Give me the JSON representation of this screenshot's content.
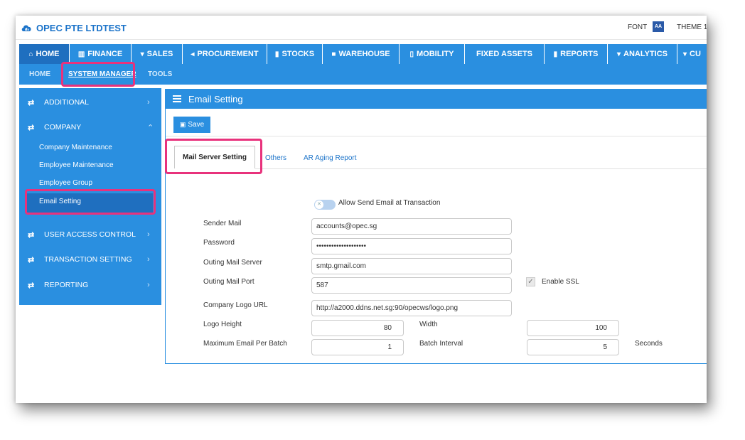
{
  "app": {
    "title": "OPEC PTE LTDTEST",
    "font_label": "FONT",
    "font_icon_text": "AA",
    "theme_label": "THEME 1"
  },
  "topnav": [
    {
      "label": "HOME",
      "icon": "home-icon"
    },
    {
      "label": "FINANCE",
      "icon": "bank-icon"
    },
    {
      "label": "SALES",
      "icon": "cart-icon"
    },
    {
      "label": "PROCUREMENT",
      "icon": "megaphone-icon"
    },
    {
      "label": "STOCKS",
      "icon": "bar-chart-icon"
    },
    {
      "label": "WAREHOUSE",
      "icon": "square-icon"
    },
    {
      "label": "MOBILITY",
      "icon": "mobile-icon"
    },
    {
      "label": "FIXED ASSETS",
      "icon": ""
    },
    {
      "label": "REPORTS",
      "icon": "chart-icon"
    },
    {
      "label": "ANALYTICS",
      "icon": "cart-icon"
    },
    {
      "label": "CU",
      "icon": "cart-icon"
    }
  ],
  "subnav": [
    {
      "label": "HOME"
    },
    {
      "label": "SYSTEM MANAGER"
    },
    {
      "label": "TOOLS"
    }
  ],
  "sidebar": {
    "groups": [
      {
        "label": "ADDITIONAL",
        "chevron": "›"
      },
      {
        "label": "COMPANY",
        "chevron": "⌃"
      },
      {
        "label": "USER ACCESS CONTROL",
        "chevron": "›"
      },
      {
        "label": "TRANSACTION SETTING",
        "chevron": "›"
      },
      {
        "label": "REPORTING",
        "chevron": "›"
      }
    ],
    "company_items": [
      "Company Maintenance",
      "Employee Maintenance",
      "Employee Group",
      "Email Setting"
    ]
  },
  "content": {
    "title": "Email Setting",
    "save_label": "Save",
    "tabs": [
      "Mail Server Setting",
      "Others",
      "AR Aging Report"
    ],
    "toggle_label": "Allow Send Email at Transaction",
    "fields": {
      "sender_mail": {
        "label": "Sender Mail",
        "value": "accounts@opec.sg"
      },
      "password": {
        "label": "Password",
        "value": "••••••••••••••••••••"
      },
      "outing_server": {
        "label": "Outing Mail Server",
        "value": "smtp.gmail.com"
      },
      "outing_port": {
        "label": "Outing Mail Port",
        "value": "587"
      },
      "enable_ssl": {
        "label": "Enable SSL"
      },
      "logo_url": {
        "label": "Company Logo URL",
        "value": "http://a2000.ddns.net.sg:90/opecws/logo.png"
      },
      "logo_height": {
        "label": "Logo Height",
        "value": "80"
      },
      "width": {
        "label": "Width",
        "value": "100"
      },
      "max_email": {
        "label": "Maximum Email Per Batch",
        "value": "1"
      },
      "batch_interval": {
        "label": "Batch Interval",
        "value": "5"
      },
      "seconds": {
        "label": "Seconds"
      }
    }
  },
  "colors": {
    "primary": "#2a8fe0",
    "primary_dark": "#1f6fbf",
    "brand": "#1b73c9",
    "highlight": "#e8327c"
  }
}
